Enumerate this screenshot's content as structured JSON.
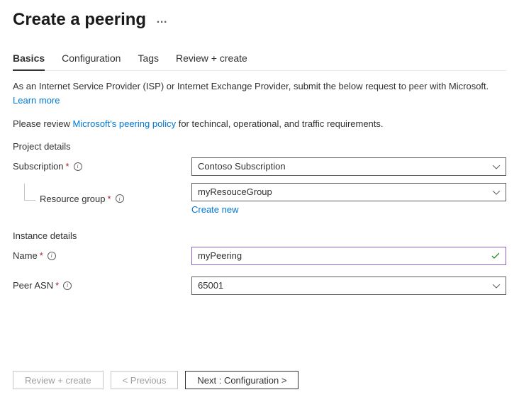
{
  "header": {
    "title": "Create a peering",
    "ellipsis": "…"
  },
  "tabs": {
    "items": [
      {
        "label": "Basics",
        "active": true
      },
      {
        "label": "Configuration",
        "active": false
      },
      {
        "label": "Tags",
        "active": false
      },
      {
        "label": "Review + create",
        "active": false
      }
    ]
  },
  "intro": {
    "line1": "As an Internet Service Provider (ISP) or Internet Exchange Provider, submit the below request to peer with Microsoft.",
    "learn_more": "Learn more",
    "line2_prefix": "Please review ",
    "policy_link": "Microsoft's peering policy",
    "line2_suffix": " for techincal, operational, and traffic requirements."
  },
  "sections": {
    "project_details": "Project details",
    "instance_details": "Instance details"
  },
  "fields": {
    "subscription": {
      "label": "Subscription",
      "value": "Contoso Subscription"
    },
    "resource_group": {
      "label": "Resource group",
      "value": "myResouceGroup",
      "create_new": "Create new"
    },
    "name": {
      "label": "Name",
      "value": "myPeering"
    },
    "peer_asn": {
      "label": "Peer ASN",
      "value": "65001"
    }
  },
  "buttons": {
    "review_create": "Review + create",
    "previous": "< Previous",
    "next": "Next : Configuration >"
  }
}
